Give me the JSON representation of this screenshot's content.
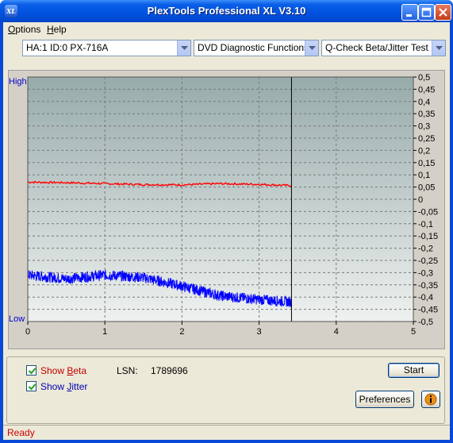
{
  "window": {
    "title": "PlexTools Professional XL  V3.10",
    "app_icon": "XL"
  },
  "menu": [
    {
      "label": "Options",
      "mnemonic": "O",
      "rest": "ptions"
    },
    {
      "label": "Help",
      "mnemonic": "H",
      "rest": "elp"
    }
  ],
  "toolbar": {
    "drive": "HA:1 ID:0  PX-716A",
    "function": "DVD Diagnostic Functions",
    "test": "Q-Check Beta/Jitter Test"
  },
  "chart_data": {
    "type": "line",
    "x": {
      "ticks": [
        "0",
        "1",
        "2",
        "3",
        "4",
        "5"
      ],
      "range": [
        0,
        5
      ]
    },
    "y_left": {
      "labels": [
        "High",
        "Low"
      ]
    },
    "y_right": {
      "range": [
        -0.5,
        0.5
      ],
      "ticks": [
        "0,5",
        "0,45",
        "0,4",
        "0,35",
        "0,3",
        "0,25",
        "0,2",
        "0,15",
        "0,1",
        "0,05",
        "0",
        "-0,05",
        "-0,1",
        "-0,15",
        "-0,2",
        "-0,25",
        "-0,3",
        "-0,35",
        "-0,4",
        "-0,45",
        "-0,5"
      ]
    },
    "cursor_x": 3.42,
    "series": [
      {
        "color": "#ff0000",
        "x": [
          0,
          0.5,
          1.0,
          1.5,
          2.0,
          2.5,
          3.0,
          3.42
        ],
        "values": [
          0.07,
          0.068,
          0.064,
          0.06,
          0.059,
          0.064,
          0.061,
          0.056
        ]
      },
      {
        "color": "#0000ff",
        "x": [
          0,
          0.5,
          1.0,
          1.5,
          2.0,
          2.5,
          3.0,
          3.42
        ],
        "values": [
          -0.31,
          -0.325,
          -0.31,
          -0.32,
          -0.355,
          -0.395,
          -0.41,
          -0.42
        ]
      }
    ],
    "grid": true
  },
  "controls": {
    "show_beta": {
      "label": "Show Beta",
      "mnemonic": "B",
      "pre": "Show ",
      "rest": "eta",
      "checked": true
    },
    "show_jitter": {
      "label": "Show Jitter",
      "mnemonic": "J",
      "pre": "Show ",
      "rest": "itter",
      "checked": true
    },
    "lsn_label": "LSN:",
    "lsn_value": "1789696",
    "start": "Start",
    "preferences": "Preferences",
    "info_icon": "info-icon"
  },
  "status": "Ready"
}
